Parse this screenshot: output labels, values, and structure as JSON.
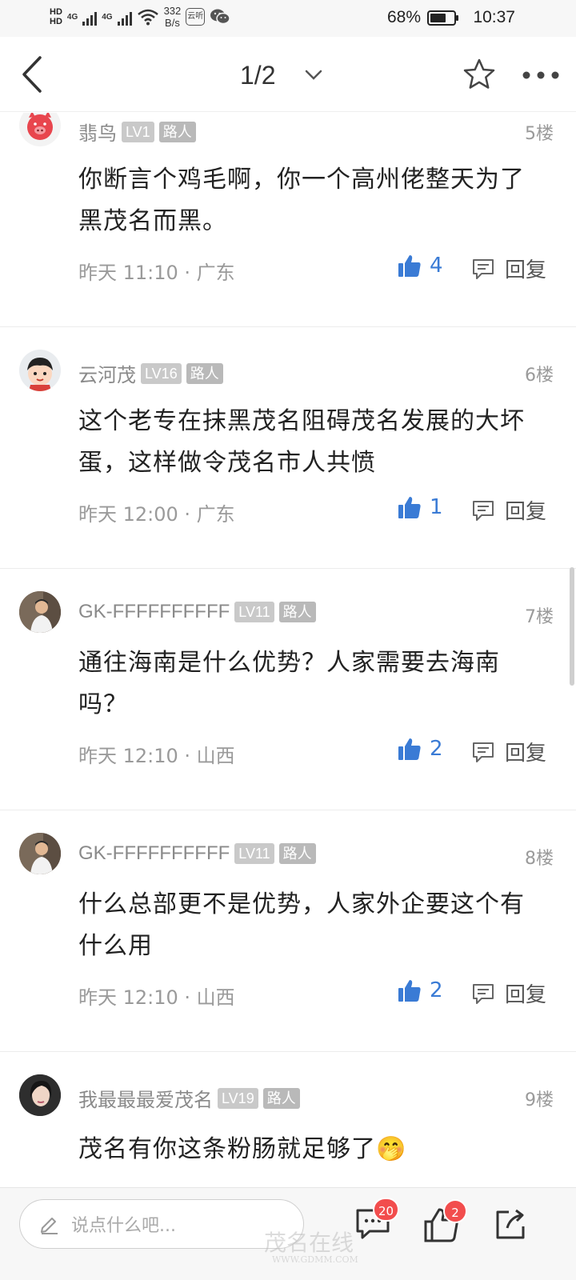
{
  "status_bar": {
    "hd1": "HD",
    "hd2": "HD",
    "net1": "4G",
    "net2": "4G",
    "speed_value": "332",
    "speed_unit": "B/s",
    "app_icon_text": "云听",
    "battery_percent": "68%",
    "battery_level": 0.68,
    "time": "10:37"
  },
  "nav": {
    "page_indicator": "1/2"
  },
  "comments": [
    {
      "username": "翡鸟",
      "level": "LV1",
      "role": "路人",
      "floor": "5楼",
      "content": "你断言个鸡毛啊，你一个高州佬整天为了黑茂名而黑。",
      "time": "昨天 11:10 · 广东",
      "likes": "4",
      "reply_label": "回复"
    },
    {
      "username": "云河茂",
      "level": "LV16",
      "role": "路人",
      "floor": "6楼",
      "content": "这个老专在抹黑茂名阻碍茂名发展的大坏蛋，这样做令茂名市人共愤",
      "time": "昨天 12:00 · 广东",
      "likes": "1",
      "reply_label": "回复"
    },
    {
      "username": "GK-FFFFFFFFFF",
      "level": "LV11",
      "role": "路人",
      "floor": "7楼",
      "content": "通往海南是什么优势？人家需要去海南吗？",
      "time": "昨天 12:10 · 山西",
      "likes": "2",
      "reply_label": "回复"
    },
    {
      "username": "GK-FFFFFFFFFF",
      "level": "LV11",
      "role": "路人",
      "floor": "8楼",
      "content": "什么总部更不是优势，人家外企要这个有什么用",
      "time": "昨天 12:10 · 山西",
      "likes": "2",
      "reply_label": "回复"
    },
    {
      "username": "我最最最爱茂名",
      "level": "LV19",
      "role": "路人",
      "floor": "9楼",
      "content": "茂名有你这条粉肠就足够了",
      "emoji": "🤭"
    }
  ],
  "bottom_bar": {
    "input_placeholder": "说点什么吧...",
    "comment_count": "20",
    "like_count": "2"
  },
  "watermark": {
    "text": "茂名在线",
    "url": "WWW.GDMM.COM"
  },
  "colors": {
    "accent_blue": "#3a7bd5",
    "badge_red": "#f24d4d"
  }
}
